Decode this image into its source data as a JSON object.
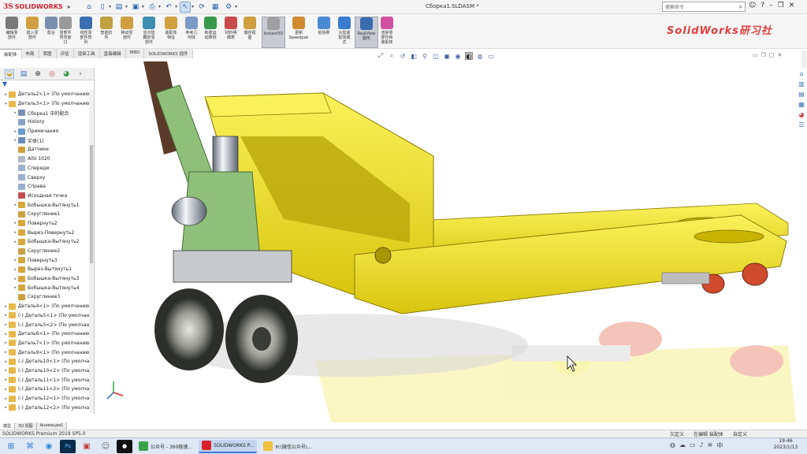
{
  "app": {
    "logo_text": "SOLIDWORKS",
    "document_title": "Сборка1.SLDASM *",
    "search_placeholder": "搜索命令",
    "brand_overlay": "SolidWorks研习社"
  },
  "ribbon": {
    "buttons": [
      {
        "label": "编辑零\n部件"
      },
      {
        "label": "插入零\n部件"
      },
      {
        "label": "配合"
      },
      {
        "label": "零部件\n预览窗\n口"
      },
      {
        "label": "线性零\n部件阵\n列"
      },
      {
        "label": "智能扣\n件"
      },
      {
        "label": "移动零\n部件"
      },
      {
        "label": "显示隐\n藏的零\n部件"
      },
      {
        "label": "装配体\n特征"
      },
      {
        "label": "参考几\n何体"
      },
      {
        "label": "新建运\n动算例"
      },
      {
        "label": "材料明\n细表"
      },
      {
        "label": "爆炸视\n图"
      },
      {
        "label": "Instant3D"
      },
      {
        "label": "更新\nSpeedpak"
      },
      {
        "label": "拍快照"
      },
      {
        "label": "大型装\n配体模\n式"
      },
      {
        "label": "RealView\n图形"
      },
      {
        "label": "渲染零\n部件和\n装配体"
      }
    ]
  },
  "command_tabs": [
    "装配体",
    "布局",
    "草图",
    "评估",
    "渲染工具",
    "直接编辑",
    "MBD",
    "SOLIDWORKS 插件"
  ],
  "feature_tree": {
    "items": [
      {
        "label": "Деталь2<1> (По умолчанию<",
        "level": 0,
        "expand": "▸",
        "icon": "#e8b84a"
      },
      {
        "label": "Деталь3<1> (По умолчанию<",
        "level": 0,
        "expand": "▾",
        "icon": "#e8b84a"
      },
      {
        "label": "Сборка1 中的配合",
        "level": 1,
        "expand": "▸",
        "icon": "#7a8fb0"
      },
      {
        "label": "History",
        "level": 1,
        "expand": "",
        "icon": "#8aa0c0"
      },
      {
        "label": "Примечания",
        "level": 1,
        "expand": "▸",
        "icon": "#6a9ad0"
      },
      {
        "label": "实体(1)",
        "level": 1,
        "expand": "▸",
        "icon": "#6a8ab8"
      },
      {
        "label": "Датчики",
        "level": 1,
        "expand": "",
        "icon": "#d0a040"
      },
      {
        "label": "AISI 1020",
        "level": 1,
        "expand": "",
        "icon": "#b0b8c8"
      },
      {
        "label": "Спереди",
        "level": 1,
        "expand": "",
        "icon": "#9ab0cc"
      },
      {
        "label": "Сверху",
        "level": 1,
        "expand": "",
        "icon": "#9ab0cc"
      },
      {
        "label": "Справа",
        "level": 1,
        "expand": "",
        "icon": "#9ab0cc"
      },
      {
        "label": "Исходная точка",
        "level": 1,
        "expand": "",
        "icon": "#c05050"
      },
      {
        "label": "Бобышка-Вытянуть1",
        "level": 1,
        "expand": "▸",
        "icon": "#d4a83c"
      },
      {
        "label": "Скругление1",
        "level": 1,
        "expand": "",
        "icon": "#c8a040"
      },
      {
        "label": "Повернуть2",
        "level": 1,
        "expand": "▸",
        "icon": "#d4a83c"
      },
      {
        "label": "Вырез-Повернуть2",
        "level": 1,
        "expand": "▸",
        "icon": "#d4a83c"
      },
      {
        "label": "Бобышка-Вытянуть2",
        "level": 1,
        "expand": "▸",
        "icon": "#d4a83c"
      },
      {
        "label": "Скругление2",
        "level": 1,
        "expand": "",
        "icon": "#c8a040"
      },
      {
        "label": "Повернуть3",
        "level": 1,
        "expand": "▸",
        "icon": "#d4a83c"
      },
      {
        "label": "Вырез-Вытянуть1",
        "level": 1,
        "expand": "▸",
        "icon": "#d4a83c"
      },
      {
        "label": "Бобышка-Вытянуть3",
        "level": 1,
        "expand": "▸",
        "icon": "#d4a83c"
      },
      {
        "label": "Бобышка-Вытянуть4",
        "level": 1,
        "expand": "▸",
        "icon": "#d4a83c"
      },
      {
        "label": "Скругление3",
        "level": 1,
        "expand": "",
        "icon": "#c8a040"
      },
      {
        "label": "Деталь4<1> (По умолчанию<",
        "level": 0,
        "expand": "▸",
        "icon": "#e8b84a"
      },
      {
        "label": "(-) Деталь5<1> (По умолчан",
        "level": 0,
        "expand": "▸",
        "icon": "#e8b84a"
      },
      {
        "label": "(-) Деталь5<2> (По умолчан",
        "level": 0,
        "expand": "▸",
        "icon": "#e8b84a"
      },
      {
        "label": "Деталь6<1> (По умолчанию<",
        "level": 0,
        "expand": "▸",
        "icon": "#e8b84a"
      },
      {
        "label": "Деталь7<1> (По умолчанию<",
        "level": 0,
        "expand": "▸",
        "icon": "#e8b84a"
      },
      {
        "label": "Деталь9<1> (По умолчанию<",
        "level": 0,
        "expand": "▸",
        "icon": "#e8b84a"
      },
      {
        "label": "(-) Деталь10<1> (По умолча",
        "level": 0,
        "expand": "▸",
        "icon": "#e8b84a"
      },
      {
        "label": "(-) Деталь10<2> (По умолча",
        "level": 0,
        "expand": "▸",
        "icon": "#e8b84a"
      },
      {
        "label": "(-) Деталь11<1> (По умолча",
        "level": 0,
        "expand": "▸",
        "icon": "#e8b84a"
      },
      {
        "label": "(-) Деталь11<2> (По умолча",
        "level": 0,
        "expand": "▸",
        "icon": "#e8b84a"
      },
      {
        "label": "(-) Деталь12<1> (По умолча",
        "level": 0,
        "expand": "▸",
        "icon": "#e8b84a"
      },
      {
        "label": "(-) Деталь12<2> (По умолча",
        "level": 0,
        "expand": "▸",
        "icon": "#e8b84a"
      }
    ]
  },
  "bottom_tabs": [
    "模型",
    "3D 视图",
    "Анимация1"
  ],
  "status": {
    "product": "SOLIDWORKS Premium 2019 SP5.0",
    "constraint": "欠定义",
    "mode": "在编辑 装配体",
    "units": "自定义"
  },
  "taskbar": {
    "apps": [
      {
        "label": "公众号 - 360极速...",
        "color": "#3aa34a"
      },
      {
        "label": "SOLIDWORKS P...",
        "color": "#d8232a"
      },
      {
        "label": "H:\\微信公众号\\...",
        "color": "#f0c040"
      }
    ],
    "time": "19:46",
    "date": "2023/1/13"
  },
  "colors": {
    "accent": "#2b64b1",
    "pallet_yellow": "#f5e61e",
    "handle_green": "#8fc07a",
    "brand_red": "#d8232a"
  }
}
